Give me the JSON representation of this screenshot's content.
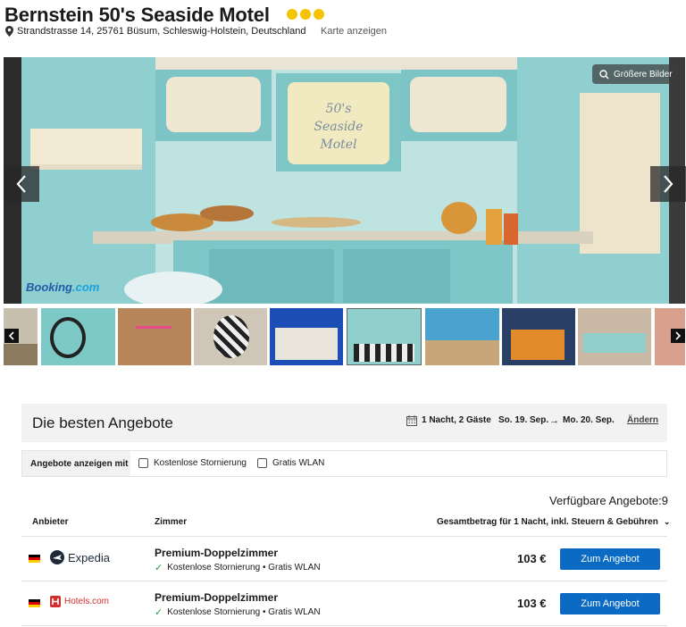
{
  "hotel": {
    "name": "Bernstein 50's Seaside Motel",
    "stars": 3,
    "address": "Strandstrasse 14, 25761 Büsum, Schleswig-Holstein, Deutschland",
    "map_link": "Karte anzeigen",
    "colors": {
      "star": "#f5c400"
    }
  },
  "gallery": {
    "bigger_images_label": "Größere Bilder",
    "watermark": "Booking.com",
    "thumbnail_count": 9,
    "active_thumbnail_index": 5
  },
  "offers": {
    "title": "Die besten Angebote",
    "stay": "1 Nacht, 2 Gäste",
    "date_from": "So. 19. Sep.",
    "date_to": "Mo. 20. Sep.",
    "change_link": "Ändern",
    "filter_label": "Angebote anzeigen mit",
    "filters": [
      {
        "label": "Kostenlose Stornierung",
        "checked": false
      },
      {
        "label": "Gratis WLAN",
        "checked": false
      }
    ],
    "available": "Verfügbare Angebote:9",
    "columns": {
      "provider": "Anbieter",
      "room": "Zimmer",
      "total": "Gesamtbetrag für 1 Nacht, inkl. Steuern & Gebühren"
    },
    "rows": [
      {
        "provider": "Expedia",
        "room": "Premium-Doppelzimmer",
        "features": "Kostenlose Stornierung • Gratis WLAN",
        "price": "103 €",
        "button": "Zum Angebot"
      },
      {
        "provider": "Hotels.com",
        "room": "Premium-Doppelzimmer",
        "features": "Kostenlose Stornierung • Gratis WLAN",
        "price": "103 €",
        "button": "Zum Angebot"
      }
    ],
    "colors": {
      "button": "#0a6ac4",
      "check": "#2e9e3e"
    }
  }
}
